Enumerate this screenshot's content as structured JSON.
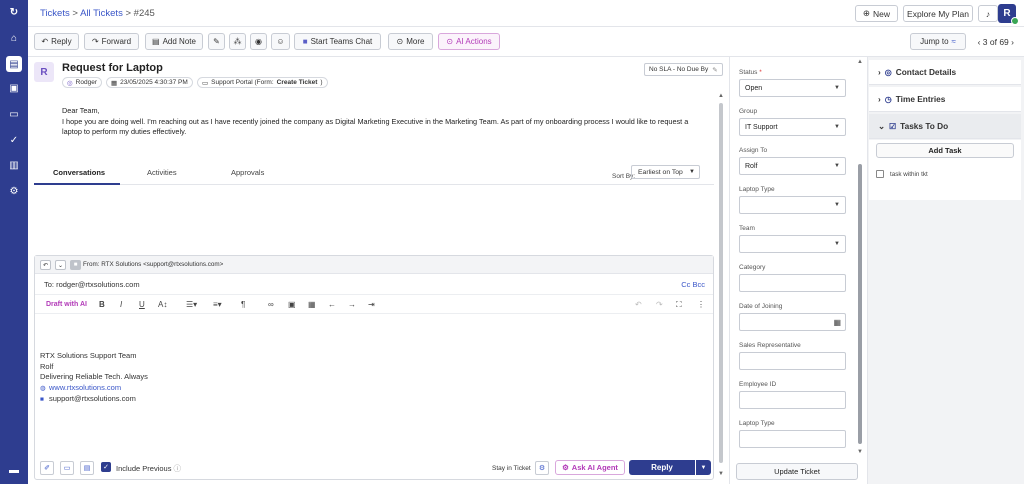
{
  "breadcrumb": {
    "tickets": "Tickets",
    "sep1": ">",
    "all": "All Tickets",
    "sep2": ">",
    "id": "#245"
  },
  "header": {
    "new_label": "New",
    "explore_label": "Explore My Plan",
    "avatar_initial": "R"
  },
  "toolbar": {
    "reply": "Reply",
    "forward": "Forward",
    "add_note": "Add Note",
    "teams_chat": "Start Teams Chat",
    "more": "More",
    "ai_actions": "AI Actions",
    "jump_to": "Jump to",
    "pager": "3 of 69"
  },
  "ticket": {
    "avatar_initial": "R",
    "title": "Request for Laptop",
    "requester": "Rodger",
    "date": "23/05/2025 4:30:37 PM",
    "source_prefix": "Support Portal (Form: ",
    "source_form": "Create Ticket",
    "source_suffix": ")",
    "sla": "No SLA - No Due By",
    "greeting": "Dear Team,",
    "body": "I hope you are doing well. I'm reaching out as I have recently joined the company as Digital Marketing Executive in the Marketing Team. As part of my onboarding process I would like to request a laptop to perform my duties effectively."
  },
  "tabs": {
    "conversations": "Conversations",
    "activities": "Activities",
    "approvals": "Approvals",
    "sort_label": "Sort By:",
    "sort_value": "Earliest on Top"
  },
  "editor": {
    "from": "From:  RTX Solutions <support@rtxsolutions.com>",
    "to": "To: rodger@rtxsolutions.com",
    "cc": "Cc",
    "bcc": "Bcc",
    "draft_ai": "Draft with AI",
    "signature": {
      "line1": "RTX Solutions Support Team",
      "line2": "Rolf",
      "line3": "Delivering Reliable Tech. Always",
      "website": "www.rtxsolutions.com",
      "email": "support@rtxsolutions.com"
    },
    "include_previous": "Include Previous",
    "stay_in_ticket": "Stay in Ticket",
    "ask_ai": "Ask AI Agent",
    "reply": "Reply"
  },
  "properties": {
    "status_label": "Status",
    "status_value": "Open",
    "group_label": "Group",
    "group_value": "IT Support",
    "assign_label": "Assign To",
    "assign_value": "Rolf",
    "laptop_type_label": "Laptop Type",
    "laptop_type_value": "",
    "team_label": "Team",
    "team_value": "",
    "category_label": "Category",
    "category_value": "",
    "doj_label": "Date of Joining",
    "doj_value": "",
    "sales_label": "Sales Representative",
    "sales_value": "",
    "emp_label": "Employee ID",
    "emp_value": "",
    "laptop_type2_label": "Laptop Type",
    "laptop_type2_value": "",
    "update_button": "Update Ticket"
  },
  "right_panel": {
    "contact_details": "Contact Details",
    "time_entries": "Time Entries",
    "tasks_to_do": "Tasks To Do",
    "add_task": "Add Task",
    "task1": "task within tkt"
  }
}
